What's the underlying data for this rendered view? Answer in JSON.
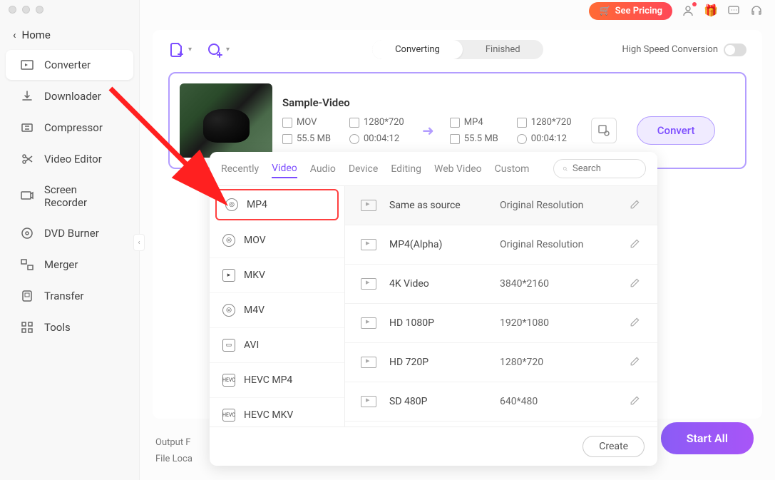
{
  "window": {
    "home": "Home"
  },
  "sidebar": {
    "items": [
      {
        "label": "Converter"
      },
      {
        "label": "Downloader"
      },
      {
        "label": "Compressor"
      },
      {
        "label": "Video Editor"
      },
      {
        "label": "Screen Recorder"
      },
      {
        "label": "DVD Burner"
      },
      {
        "label": "Merger"
      },
      {
        "label": "Transfer"
      },
      {
        "label": "Tools"
      }
    ]
  },
  "topbar": {
    "pricing": "See Pricing"
  },
  "header": {
    "seg_converting": "Converting",
    "seg_finished": "Finished",
    "hsc": "High Speed Conversion"
  },
  "video": {
    "title": "Sample-Video",
    "src": {
      "format": "MOV",
      "res": "1280*720",
      "size": "55.5 MB",
      "dur": "00:04:12"
    },
    "dst": {
      "format": "MP4",
      "res": "1280*720",
      "size": "55.5 MB",
      "dur": "00:04:12"
    },
    "convert": "Convert"
  },
  "panel": {
    "tabs": [
      "Recently",
      "Video",
      "Audio",
      "Device",
      "Editing",
      "Web Video",
      "Custom"
    ],
    "search_placeholder": "Search",
    "formats": [
      "MP4",
      "MOV",
      "MKV",
      "M4V",
      "AVI",
      "HEVC MP4",
      "HEVC MKV"
    ],
    "resolutions": [
      {
        "name": "Same as source",
        "value": "Original Resolution"
      },
      {
        "name": "MP4(Alpha)",
        "value": "Original Resolution"
      },
      {
        "name": "4K Video",
        "value": "3840*2160"
      },
      {
        "name": "HD 1080P",
        "value": "1920*1080"
      },
      {
        "name": "HD 720P",
        "value": "1280*720"
      },
      {
        "name": "SD 480P",
        "value": "640*480"
      }
    ],
    "create": "Create"
  },
  "footer": {
    "output": "Output F",
    "location": "File Loca",
    "start_all": "Start All"
  }
}
